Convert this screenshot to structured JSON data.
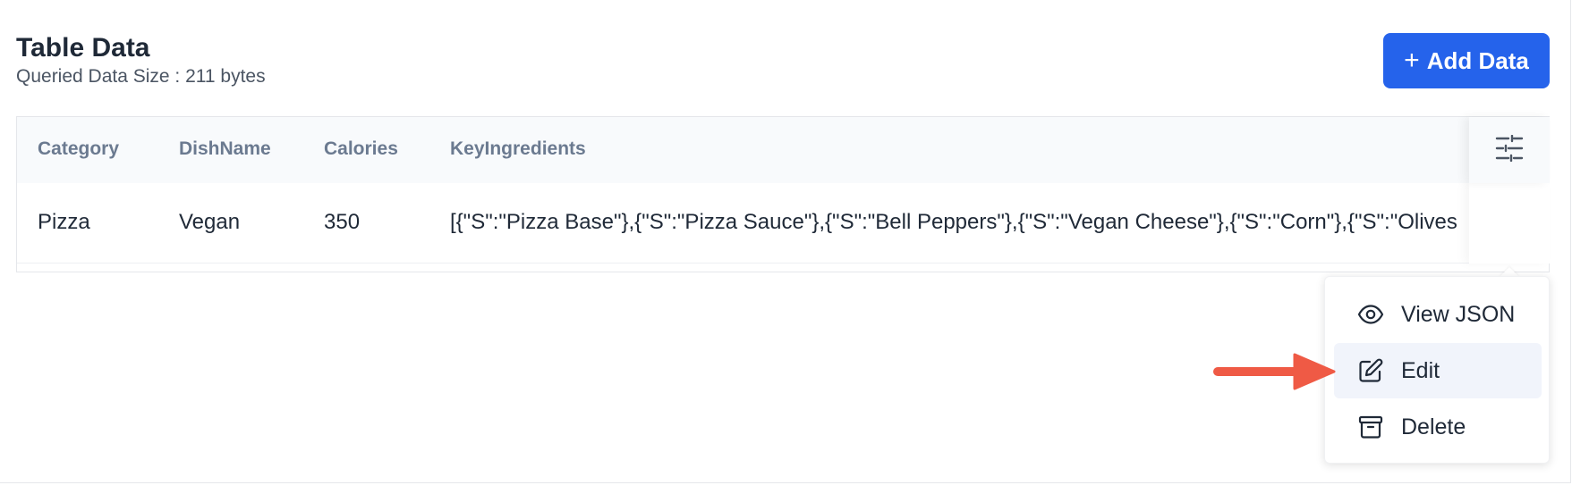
{
  "header": {
    "title": "Table Data",
    "subtitle": "Queried Data Size : 211 bytes",
    "add_button_label": "Add Data",
    "add_button_icon": "plus-icon"
  },
  "table": {
    "columns": [
      "Category",
      "DishName",
      "Calories",
      "KeyIngredients"
    ],
    "rows": [
      {
        "category": "Pizza",
        "dish_name": "Vegan",
        "calories": "350",
        "key_ingredients": "[{\"S\":\"Pizza Base\"},{\"S\":\"Pizza Sauce\"},{\"S\":\"Bell Peppers\"},{\"S\":\"Vegan Cheese\"},{\"S\":\"Corn\"},{\"S\":\"Olives"
      }
    ],
    "settings_icon": "column-settings-icon"
  },
  "row_menu": {
    "items": [
      {
        "label": "View JSON",
        "icon": "eye-icon"
      },
      {
        "label": "Edit",
        "icon": "edit-icon",
        "highlighted": true
      },
      {
        "label": "Delete",
        "icon": "archive-icon"
      }
    ]
  },
  "colors": {
    "primary": "#2563eb",
    "arrow": "#ef5a45",
    "header_bg": "#f8fafc",
    "muted_text": "#6b7a90"
  }
}
